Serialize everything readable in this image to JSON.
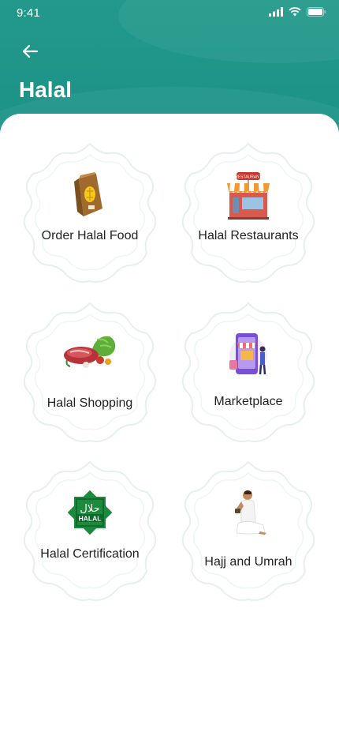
{
  "status_bar": {
    "time": "9:41"
  },
  "header": {
    "title": "Halal"
  },
  "tiles": [
    {
      "label": "Order Halal Food",
      "icon": "halal-food-bag-icon"
    },
    {
      "label": "Halal Restaurants",
      "icon": "restaurant-icon",
      "sign": "RESTAURANT"
    },
    {
      "label": "Halal Shopping",
      "icon": "groceries-icon"
    },
    {
      "label": "Marketplace",
      "icon": "marketplace-icon"
    },
    {
      "label": "Halal Certification",
      "icon": "halal-certificate-icon",
      "badge_arabic": "حلال",
      "badge_latin": "HALAL"
    },
    {
      "label": "Hajj and Umrah",
      "icon": "pilgrim-praying-icon"
    }
  ],
  "colors": {
    "header": "#1e9488",
    "frame": "#e4f1f0",
    "text": "#222222"
  }
}
